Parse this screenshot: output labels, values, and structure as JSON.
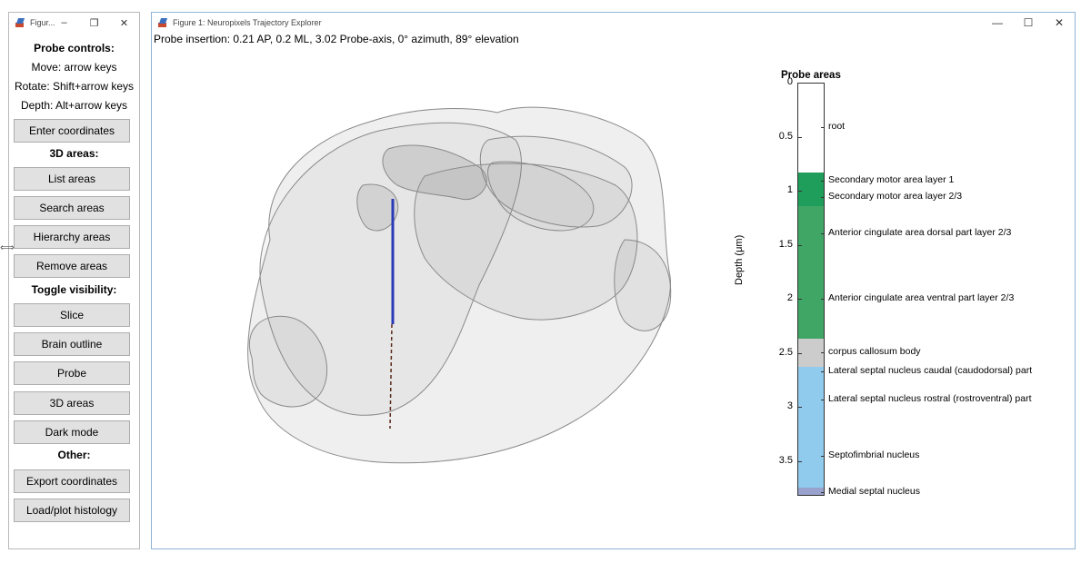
{
  "controls_window": {
    "title": "Figur...",
    "minimize": "–",
    "maximize": "❐",
    "close": "✕",
    "probe_controls_heading": "Probe controls:",
    "move_text": "Move: arrow keys",
    "rotate_text": "Rotate: Shift+arrow keys",
    "depth_text": "Depth: Alt+arrow keys",
    "enter_coordinates": "Enter coordinates",
    "areas_3d_heading": "3D areas:",
    "list_areas": "List areas",
    "search_areas": "Search areas",
    "hierarchy_areas": "Hierarchy areas",
    "remove_areas": "Remove areas",
    "toggle_heading": "Toggle visibility:",
    "slice": "Slice",
    "brain_outline": "Brain outline",
    "probe": "Probe",
    "areas_3d": "3D areas",
    "dark_mode": "Dark mode",
    "other_heading": "Other:",
    "export_coordinates": "Export coordinates",
    "load_histology": "Load/plot histology",
    "resize_glyph": "⟺"
  },
  "figure_window": {
    "title": "Figure 1: Neuropixels Trajectory Explorer",
    "minimize": "—",
    "maximize": "☐",
    "close": "✕",
    "insertion_text": "Probe insertion: 0.21 AP, 0.2 ML, 3.02 Probe-axis, 0° azimuth, 89° elevation"
  },
  "probe_areas": {
    "title": "Probe areas",
    "ylabel": "Depth (μm)",
    "ymax": 3.82,
    "ticks": [
      "0",
      "0.5",
      "1",
      "1.5",
      "2",
      "2.5",
      "3",
      "3.5"
    ],
    "segments": [
      {
        "start": 0,
        "end": 0.82,
        "color": "#ffffff"
      },
      {
        "start": 0.82,
        "end": 1.13,
        "color": "#1f9d5a"
      },
      {
        "start": 1.13,
        "end": 2.36,
        "color": "#40a666"
      },
      {
        "start": 2.36,
        "end": 2.62,
        "color": "#cccccc"
      },
      {
        "start": 2.62,
        "end": 3.74,
        "color": "#90cbed"
      },
      {
        "start": 3.74,
        "end": 3.82,
        "color": "#98a2cc"
      }
    ],
    "labels": [
      {
        "depth": 0.41,
        "text": "root"
      },
      {
        "depth": 0.91,
        "text": "Secondary motor area layer 1"
      },
      {
        "depth": 1.06,
        "text": "Secondary motor area layer 2/3"
      },
      {
        "depth": 1.39,
        "text": "Anterior cingulate area dorsal part layer 2/3"
      },
      {
        "depth": 2.0,
        "text": "Anterior cingulate area ventral part layer 2/3"
      },
      {
        "depth": 2.49,
        "text": "corpus callosum body"
      },
      {
        "depth": 2.67,
        "text": "Lateral septal nucleus caudal (caudodorsal) part"
      },
      {
        "depth": 2.93,
        "text": "Lateral septal nucleus rostral (rostroventral) part"
      },
      {
        "depth": 3.45,
        "text": "Septofimbrial nucleus"
      },
      {
        "depth": 3.79,
        "text": "Medial septal nucleus"
      }
    ]
  }
}
